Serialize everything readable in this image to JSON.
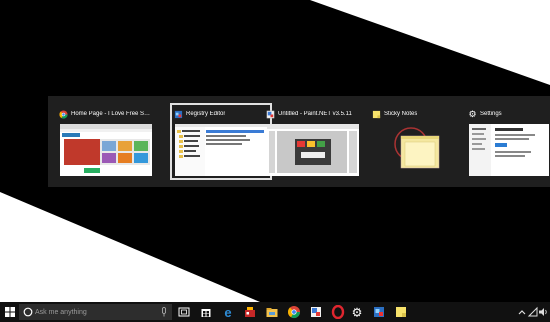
{
  "task_view": {
    "windows": [
      {
        "title": "Home Page - I Love Free Softwar...",
        "icon": "chrome-icon"
      },
      {
        "title": "Registry Editor",
        "icon": "registry-editor-icon"
      },
      {
        "title": "Untitled - Paint.NET v3.5.11",
        "icon": "paint-net-icon"
      },
      {
        "title": "Sticky Notes",
        "icon": "sticky-notes-icon"
      },
      {
        "title": "Settings",
        "icon": "settings-gear-icon"
      }
    ],
    "selected_index": 1
  },
  "taskbar": {
    "search_placeholder": "Ask me anything",
    "pinned_icons": [
      "task-view-icon",
      "store-icon",
      "edge-icon",
      "game-icon",
      "file-explorer-icon",
      "chrome-icon",
      "paint-net-icon",
      "opera-icon",
      "settings-gear-icon",
      "registry-editor-icon",
      "sticky-notes-icon"
    ],
    "tray_icons": [
      "chevron-up-icon",
      "network-icon",
      "volume-icon"
    ]
  },
  "colors": {
    "desktop_black": "#000000",
    "desktop_white": "#ffffff",
    "switcher_bg": "#1f1f1f",
    "taskbar_bg": "#111111",
    "select_outline": "#e0e0e0"
  }
}
